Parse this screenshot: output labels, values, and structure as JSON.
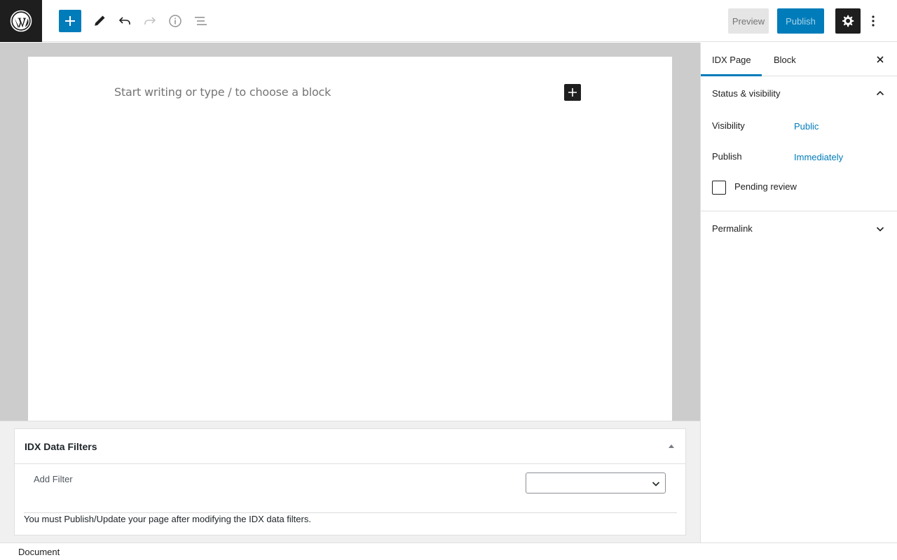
{
  "toolbar": {
    "add_block": "plus-icon",
    "preview_label": "Preview",
    "publish_label": "Publish"
  },
  "editor": {
    "placeholder": "Start writing or type / to choose a block"
  },
  "metabox": {
    "title": "IDX Data Filters",
    "add_filter_label": "Add Filter",
    "filter_select_value": "",
    "note": "You must Publish/Update your page after modifying the IDX data filters."
  },
  "sidebar": {
    "tabs": [
      {
        "label": "IDX Page",
        "active": true
      },
      {
        "label": "Block",
        "active": false
      }
    ],
    "status_panel": {
      "title": "Status & visibility",
      "visibility_label": "Visibility",
      "visibility_value": "Public",
      "publish_label": "Publish",
      "publish_value": "Immediately",
      "pending_label": "Pending review",
      "pending_checked": false
    },
    "permalink_panel": {
      "title": "Permalink"
    }
  },
  "footer": {
    "breadcrumb": "Document"
  },
  "colors": {
    "accent": "#007cba",
    "dark": "#1e1e1e",
    "canvas_bg": "#cccccc"
  }
}
